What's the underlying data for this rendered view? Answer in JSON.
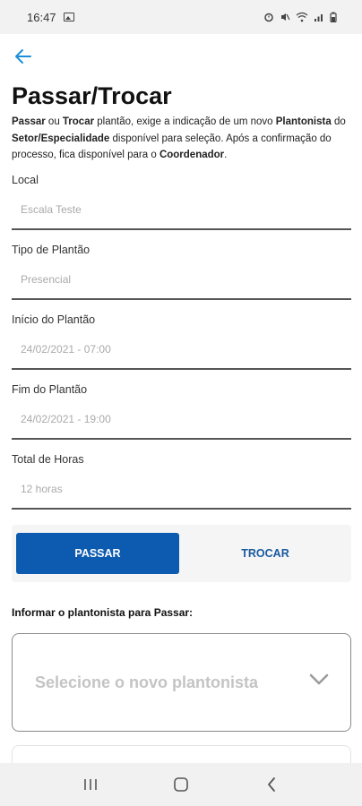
{
  "status_bar": {
    "time": "16:47",
    "indicators": "⏰ 🔇 📶 ▮"
  },
  "header": {
    "back_icon": "arrow-left-icon",
    "title": "Passar/Trocar"
  },
  "description": {
    "parts": [
      {
        "text": "Passar",
        "bold": true
      },
      {
        "text": " ou ",
        "bold": false
      },
      {
        "text": "Trocar",
        "bold": true
      },
      {
        "text": " plantão, exige a indicação de um novo ",
        "bold": false
      },
      {
        "text": "Plantonista",
        "bold": true
      },
      {
        "text": " do ",
        "bold": false
      },
      {
        "text": "Setor/Especialidade",
        "bold": true
      },
      {
        "text": "  disponível para seleção. Após a confirmação do processo, fica disponível para o ",
        "bold": false
      },
      {
        "text": "Coordenador",
        "bold": true
      },
      {
        "text": ".",
        "bold": false
      }
    ]
  },
  "fields": {
    "local": {
      "label": "Local",
      "value": "Escala Teste"
    },
    "tipo": {
      "label": "Tipo de Plantão",
      "value": "Presencial"
    },
    "inicio": {
      "label": "Início do Plantão",
      "value": "24/02/2021 - 07:00"
    },
    "fim": {
      "label": "Fim do Plantão",
      "value": "24/02/2021 - 19:00"
    },
    "total": {
      "label": "Total de Horas",
      "value": "12 horas"
    }
  },
  "toggle": {
    "passar_label": "PASSAR",
    "trocar_label": "TROCAR",
    "selected": "PASSAR",
    "active_color": "#0d5bb0"
  },
  "inform": {
    "label": "Informar o plantonista para Passar:",
    "select_placeholder": "Selecione o novo plantonista"
  },
  "nav_bar": {
    "recents_icon": "recents-icon",
    "home_icon": "home-icon",
    "back_icon": "back-chevron-icon"
  }
}
